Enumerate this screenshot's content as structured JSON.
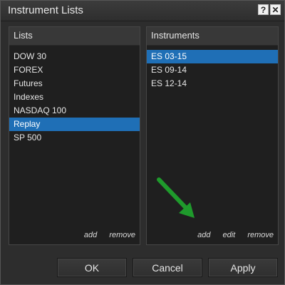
{
  "window": {
    "title": "Instrument Lists",
    "help_label": "?",
    "close_label": "✕"
  },
  "lists_panel": {
    "header": "Lists",
    "items": [
      {
        "label": "DOW 30",
        "selected": false
      },
      {
        "label": "FOREX",
        "selected": false
      },
      {
        "label": "Futures",
        "selected": false
      },
      {
        "label": "Indexes",
        "selected": false
      },
      {
        "label": "NASDAQ 100",
        "selected": false
      },
      {
        "label": "Replay",
        "selected": true
      },
      {
        "label": "SP 500",
        "selected": false
      }
    ],
    "add_label": "add",
    "remove_label": "remove"
  },
  "instruments_panel": {
    "header": "Instruments",
    "items": [
      {
        "label": "ES 03-15",
        "selected": true
      },
      {
        "label": "ES 09-14",
        "selected": false
      },
      {
        "label": "ES 12-14",
        "selected": false
      }
    ],
    "add_label": "add",
    "edit_label": "edit",
    "remove_label": "remove"
  },
  "footer": {
    "ok_label": "OK",
    "cancel_label": "Cancel",
    "apply_label": "Apply"
  },
  "colors": {
    "selection": "#1f6fb6",
    "arrow": "#1f9a2c"
  },
  "icons": {
    "arrow": "pointer-arrow-icon"
  }
}
